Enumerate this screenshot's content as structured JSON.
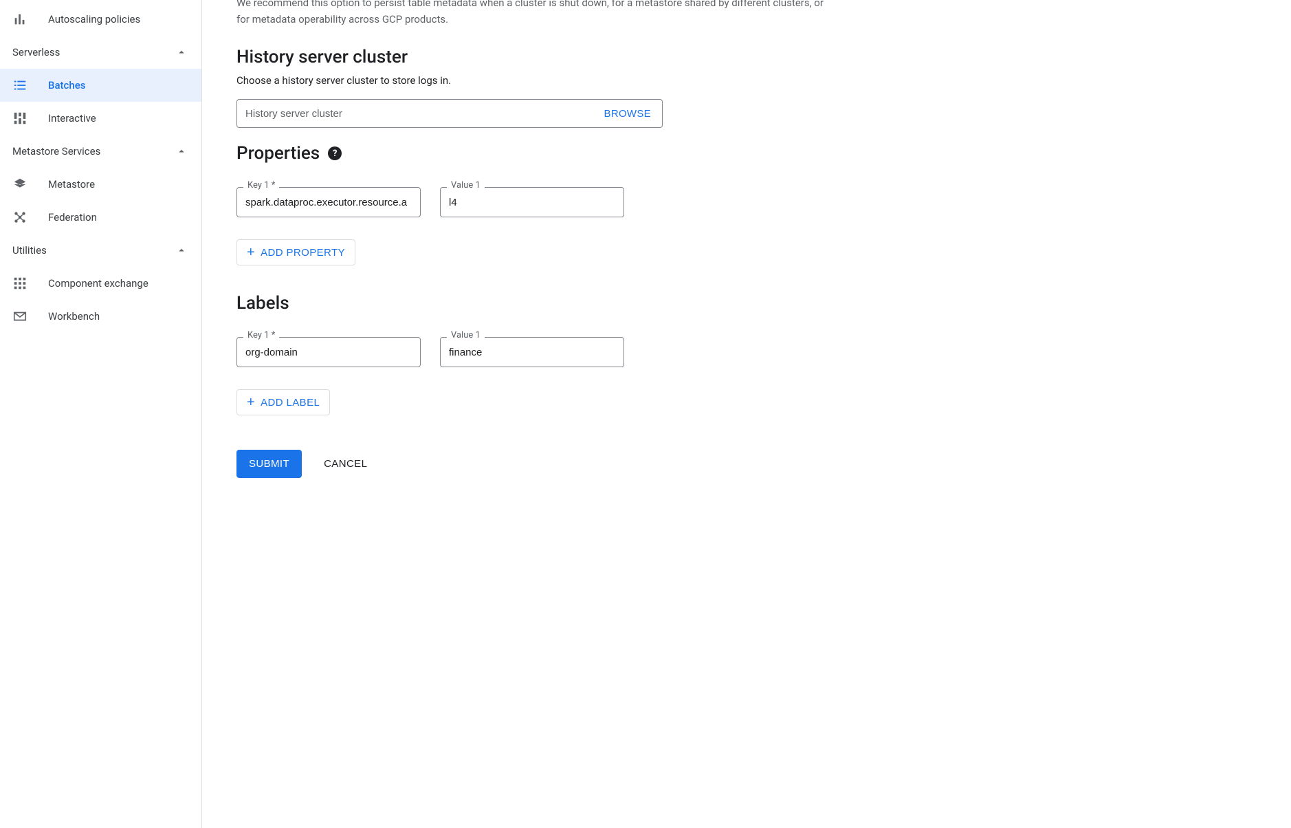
{
  "sidebar": {
    "top_item": {
      "label": "Autoscaling policies"
    },
    "groups": [
      {
        "label": "Serverless",
        "items": [
          {
            "label": "Batches",
            "active": true
          },
          {
            "label": "Interactive"
          }
        ]
      },
      {
        "label": "Metastore Services",
        "items": [
          {
            "label": "Metastore"
          },
          {
            "label": "Federation"
          }
        ]
      },
      {
        "label": "Utilities",
        "items": [
          {
            "label": "Component exchange"
          },
          {
            "label": "Workbench"
          }
        ]
      }
    ]
  },
  "main": {
    "intro_text": "We recommend this option to persist table metadata when a cluster is shut down, for a metastore shared by different clusters, or for metadata operability across GCP products.",
    "history": {
      "title": "History server cluster",
      "description": "Choose a history server cluster to store logs in.",
      "placeholder": "History server cluster",
      "browse": "BROWSE"
    },
    "properties": {
      "title": "Properties",
      "key_label": "Key 1 *",
      "value_label": "Value 1",
      "key": "spark.dataproc.executor.resource.a",
      "value": "l4",
      "add_button": "ADD PROPERTY"
    },
    "labels": {
      "title": "Labels",
      "key_label": "Key 1 *",
      "value_label": "Value 1",
      "key": "org-domain",
      "value": "finance",
      "add_button": "ADD LABEL"
    },
    "footer": {
      "submit": "SUBMIT",
      "cancel": "CANCEL"
    }
  }
}
